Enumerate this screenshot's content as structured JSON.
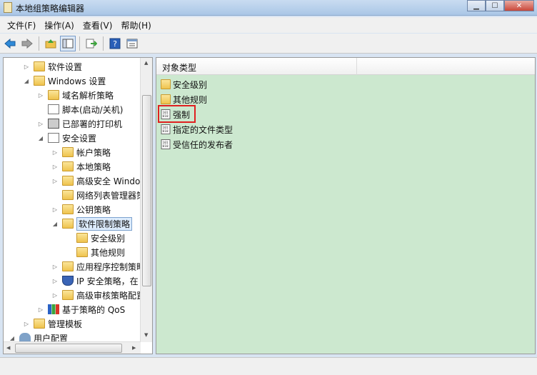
{
  "window": {
    "title": "本地组策略编辑器"
  },
  "menu": [
    "文件(F)",
    "操作(A)",
    "查看(V)",
    "帮助(H)"
  ],
  "toolbar": {
    "icons": [
      "back-arrow-icon",
      "forward-arrow-icon",
      "up-folder-icon",
      "show-hide-tree-icon",
      "export-list-icon",
      "help-icon",
      "properties-icon"
    ]
  },
  "tree": [
    {
      "label": "软件设置",
      "icon": "folder",
      "level": 2,
      "arrow": "▷"
    },
    {
      "label": "Windows 设置",
      "icon": "folder",
      "level": 2,
      "arrow": "◢"
    },
    {
      "label": "域名解析策略",
      "icon": "folder",
      "level": 3,
      "arrow": "▷"
    },
    {
      "label": "脚本(启动/关机)",
      "icon": "doc",
      "level": 3,
      "arrow": ""
    },
    {
      "label": "已部署的打印机",
      "icon": "printer",
      "level": 3,
      "arrow": "▷"
    },
    {
      "label": "安全设置",
      "icon": "doc",
      "level": 3,
      "arrow": "◢"
    },
    {
      "label": "帐户策略",
      "icon": "folder",
      "level": 4,
      "arrow": "▷"
    },
    {
      "label": "本地策略",
      "icon": "folder",
      "level": 4,
      "arrow": "▷"
    },
    {
      "label": "高级安全 Windo",
      "icon": "folder",
      "level": 4,
      "arrow": "▷"
    },
    {
      "label": "网络列表管理器策",
      "icon": "folder",
      "level": 4,
      "arrow": ""
    },
    {
      "label": "公钥策略",
      "icon": "folder",
      "level": 4,
      "arrow": "▷"
    },
    {
      "label": "软件限制策略",
      "icon": "folder",
      "level": 4,
      "arrow": "◢",
      "selected": true
    },
    {
      "label": "安全级别",
      "icon": "folder",
      "level": 5,
      "arrow": ""
    },
    {
      "label": "其他规则",
      "icon": "folder",
      "level": 5,
      "arrow": ""
    },
    {
      "label": "应用程序控制策略",
      "icon": "folder",
      "level": 4,
      "arrow": "▷"
    },
    {
      "label": "IP 安全策略，在",
      "icon": "shield",
      "level": 4,
      "arrow": "▷"
    },
    {
      "label": "高级审核策略配置",
      "icon": "folder",
      "level": 4,
      "arrow": "▷"
    },
    {
      "label": "基于策略的 QoS",
      "icon": "chart",
      "level": 3,
      "arrow": "▷"
    },
    {
      "label": "管理模板",
      "icon": "folder",
      "level": 2,
      "arrow": "▷"
    },
    {
      "label": "用户配置",
      "icon": "user",
      "level": 1,
      "arrow": "◢"
    }
  ],
  "list": {
    "column_header": "对象类型",
    "items": [
      {
        "label": "安全级别",
        "icon": "folder-icon"
      },
      {
        "label": "其他规则",
        "icon": "folder-icon"
      },
      {
        "label": "强制",
        "icon": "policy-doc-icon",
        "highlighted": true
      },
      {
        "label": "指定的文件类型",
        "icon": "policy-doc-icon"
      },
      {
        "label": "受信任的发布者",
        "icon": "policy-doc-icon"
      }
    ]
  },
  "colors": {
    "list_background": "#cce8cf",
    "highlight_border": "#e02020"
  }
}
